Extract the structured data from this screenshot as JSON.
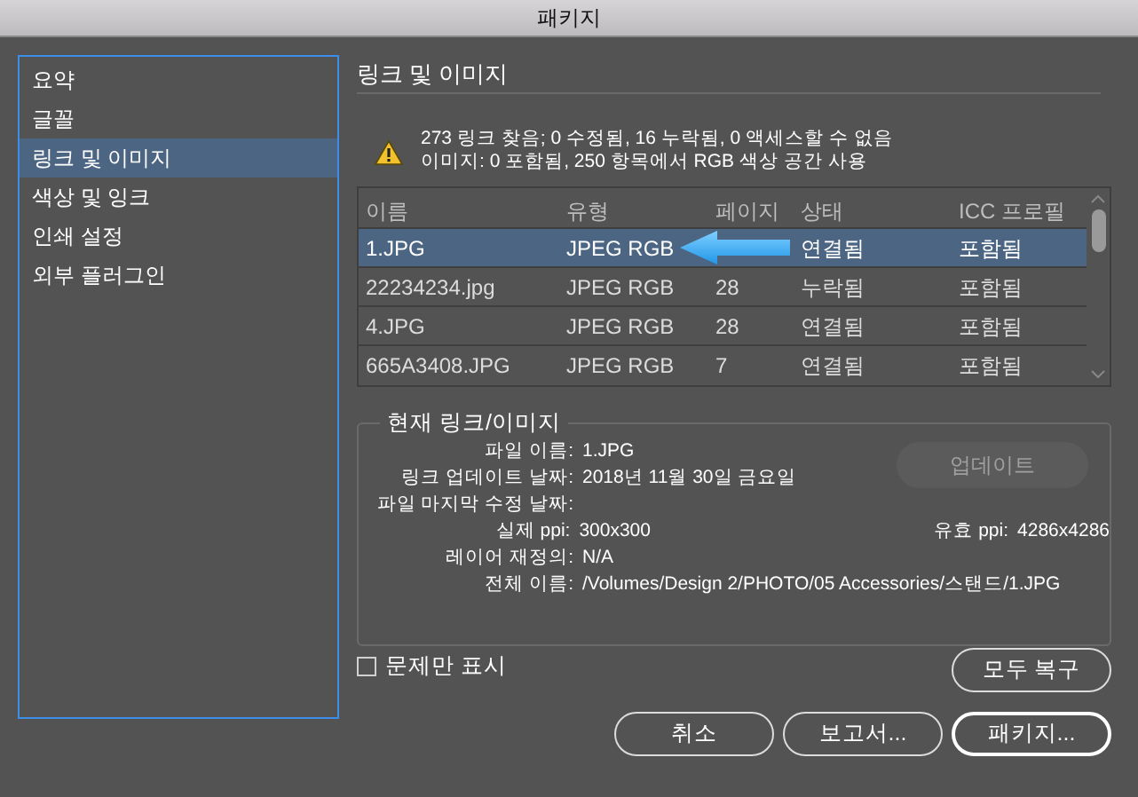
{
  "window": {
    "title": "패키지"
  },
  "sidebar": {
    "items": [
      {
        "label": "요약",
        "selected": false
      },
      {
        "label": "글꼴",
        "selected": false
      },
      {
        "label": "링크 및 이미지",
        "selected": true
      },
      {
        "label": "색상 및 잉크",
        "selected": false
      },
      {
        "label": "인쇄 설정",
        "selected": false
      },
      {
        "label": "외부 플러그인",
        "selected": false
      }
    ]
  },
  "section_title": "링크 및 이미지",
  "summary": [
    "273 링크 찾음; 0 수정됨, 16 누락됨, 0 액세스할 수 없음",
    "이미지: 0 포함됨, 250 항목에서 RGB 색상 공간 사용"
  ],
  "table": {
    "columns": [
      "이름",
      "유형",
      "페이지",
      "상태",
      "ICC 프로필"
    ],
    "rows": [
      {
        "cells": [
          "1.JPG",
          "JPEG RGB",
          "",
          "연결됨",
          "포함됨"
        ],
        "selected": true
      },
      {
        "cells": [
          "22234234.jpg",
          "JPEG RGB",
          "28",
          "누락됨",
          "포함됨"
        ],
        "selected": false
      },
      {
        "cells": [
          "4.JPG",
          "JPEG RGB",
          "28",
          "연결됨",
          "포함됨"
        ],
        "selected": false
      },
      {
        "cells": [
          "665A3408.JPG",
          "JPEG RGB",
          "7",
          "연결됨",
          "포함됨"
        ],
        "selected": false
      }
    ]
  },
  "current_link": {
    "title": "현재 링크/이미지",
    "fields": [
      {
        "label": "파일 이름:",
        "value": "1.JPG"
      },
      {
        "label": "링크 업데이트 날짜:",
        "value": "2018년 11월 30일 금요일"
      },
      {
        "label": "파일 마지막 수정 날짜:"
      },
      {
        "label": "실제 ppi:",
        "value": "300x300",
        "extra_label": "유효 ppi:",
        "extra_value": "4286x4286"
      },
      {
        "label": "레이어 재정의:",
        "value": "N/A"
      },
      {
        "label": "전체 이름:",
        "value": "/Volumes/Design 2/PHOTO/05 Accessories/스탠드/1.JPG"
      }
    ],
    "update_button": {
      "label": "업데이트",
      "disabled": true
    }
  },
  "problems_only": {
    "label": "문제만 표시",
    "checked": false
  },
  "restore_all_button": "모두 복구",
  "buttons": [
    "취소",
    "보고서...",
    "패키지..."
  ]
}
